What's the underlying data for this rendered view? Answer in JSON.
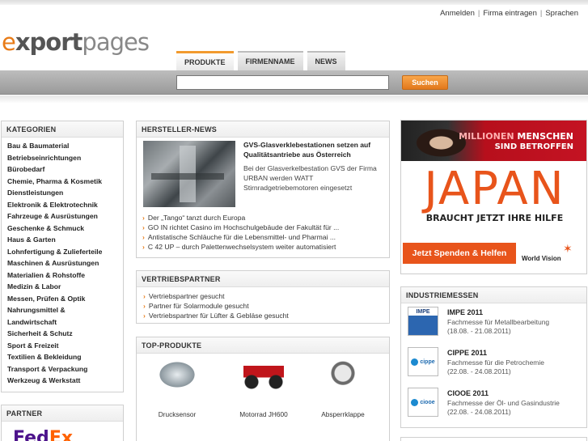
{
  "header": {
    "links": [
      "Anmelden",
      "Firma eintragen",
      "Sprachen"
    ],
    "logo": {
      "e": "e",
      "x": "xport",
      "pages": "pages"
    },
    "tabs": [
      {
        "label": "PRODUKTE",
        "active": true
      },
      {
        "label": "FIRMENNAME",
        "active": false
      },
      {
        "label": "NEWS",
        "active": false
      }
    ],
    "search": {
      "value": "",
      "button": "Suchen"
    },
    "accent_color": "#e87b17"
  },
  "categories": {
    "title": "KATEGORIEN",
    "items": [
      "Bau & Baumaterial",
      "Betriebseinrichtungen",
      "Bürobedarf",
      "Chemie, Pharma & Kosmetik",
      "Dienstleistungen",
      "Elektronik & Elektrotechnik",
      "Fahrzeuge & Ausrüstungen",
      "Geschenke & Schmuck",
      "Haus & Garten",
      "Lohnfertigung & Zulieferteile",
      "Maschinen & Ausrüstungen",
      "Materialien & Rohstoffe",
      "Medizin & Labor",
      "Messen, Prüfen & Optik",
      "Nahrungsmittel &",
      "Landwirtschaft",
      "Sicherheit & Schutz",
      "Sport & Freizeit",
      "Textilien & Bekleidung",
      "Transport & Verpackung",
      "Werkzeug & Werkstatt"
    ]
  },
  "partner": {
    "title": "PARTNER",
    "logo_fe": "Fed",
    "logo_ex": "Ex"
  },
  "news": {
    "title": "HERSTELLER-NEWS",
    "headline": "GVS-Glasverklebestationen setzen auf Qualitätsantriebe aus Österreich",
    "text": "Bei der Glasverkelbestation GVS der Firma URBAN werden WATT Stirnradgetriebemotoren eingesetzt",
    "items": [
      "Der „Tango“ tanzt durch Europa",
      "GO IN richtet Casino im Hochschulgebäude der Fakultät für ...",
      "Antistatische Schläuche für die Lebensmittel- und Pharmai ...",
      "C 42 UP – durch Palettenwechselsystem weiter automatisiert"
    ]
  },
  "vertrieb": {
    "title": "VERTRIEBSPARTNER",
    "items": [
      "Vertriebspartner gesucht",
      "Partner für Solarmodule gesucht",
      "Vertriebspartner für Lüfter & Gebläse gesucht"
    ]
  },
  "top_products": {
    "title": "TOP-PRODUKTE",
    "items": [
      {
        "label": "Drucksensor",
        "icon": "sensor-icon"
      },
      {
        "label": "Motorrad JH600",
        "icon": "motorcycle-icon"
      },
      {
        "label": "Absperrklappe",
        "icon": "valve-icon"
      }
    ]
  },
  "ad": {
    "line1a": "MILLIONEN",
    "line1b": "MENSCHEN",
    "line2": "SIND BETROFFEN",
    "big": "JAPAN",
    "sub": "BRAUCHT JETZT IHRE HILFE",
    "button": "Jetzt Spenden & Helfen",
    "brand": "World Vision"
  },
  "fairs": {
    "title": "INDUSTRIEMESSEN",
    "items": [
      {
        "logo": "IMPE",
        "name": "IMPE 2011",
        "desc": "Fachmesse für Metallbearbeitung",
        "date": "(18.08. - 21.08.2011)"
      },
      {
        "logo": "cippe",
        "name": "CIPPE 2011",
        "desc": "Fachmesse für die Petrochemie",
        "date": "(22.08. - 24.08.2011)"
      },
      {
        "logo": "ciooe",
        "name": "CIOOE 2011",
        "desc": "Fachmesse der Öl- und Gasindustrie",
        "date": "(22.08. - 24.08.2011)"
      }
    ]
  }
}
